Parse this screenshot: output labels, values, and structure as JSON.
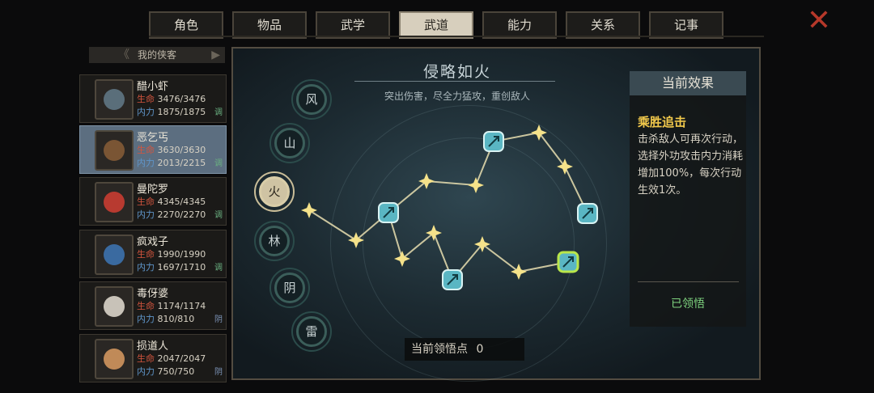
{
  "tabs": [
    {
      "label": "角色"
    },
    {
      "label": "物品"
    },
    {
      "label": "武学"
    },
    {
      "label": "武道",
      "active": true
    },
    {
      "label": "能力"
    },
    {
      "label": "关系"
    },
    {
      "label": "记事"
    }
  ],
  "close_icon": "close-x-icon",
  "hero_list": {
    "title": "我的侠客",
    "heroes": [
      {
        "name": "醋小虾",
        "hp_label": "生命",
        "hp": "3476/3476",
        "mp_label": "内力",
        "mp": "1875/1875",
        "tag": "调",
        "color": "#5a6e7a"
      },
      {
        "name": "恶乞丐",
        "hp_label": "生命",
        "hp": "3630/3630",
        "mp_label": "内力",
        "mp": "2013/2215",
        "tag": "调",
        "color": "#7a5534",
        "selected": true
      },
      {
        "name": "曼陀罗",
        "hp_label": "生命",
        "hp": "4345/4345",
        "mp_label": "内力",
        "mp": "2270/2270",
        "tag": "调",
        "color": "#b83a30"
      },
      {
        "name": "疯戏子",
        "hp_label": "生命",
        "hp": "1990/1990",
        "mp_label": "内力",
        "mp": "1697/1710",
        "tag": "调",
        "color": "#3a6aa0"
      },
      {
        "name": "毒伢婆",
        "hp_label": "生命",
        "hp": "1174/1174",
        "mp_label": "内力",
        "mp": "810/810",
        "tag": "阴",
        "color": "#c8c2b8"
      },
      {
        "name": "损道人",
        "hp_label": "生命",
        "hp": "2047/2047",
        "mp_label": "内力",
        "mp": "750/750",
        "tag": "阴",
        "color": "#c08a58"
      }
    ]
  },
  "path": {
    "title": "侵略如火",
    "subtitle": "突出伤害，尽全力猛攻，重创敌人"
  },
  "elements": [
    {
      "label": "风"
    },
    {
      "label": "山"
    },
    {
      "label": "火",
      "active": true
    },
    {
      "label": "林"
    },
    {
      "label": "阴"
    },
    {
      "label": "雷"
    }
  ],
  "effect": {
    "header": "当前效果",
    "name": "乘胜追击",
    "description": "击杀敌人可再次行动，选择外功攻击内力消耗增加100%，每次行动生效1次。",
    "status": "已领悟"
  },
  "points": {
    "label": "当前领悟点",
    "value": "0"
  },
  "colors": {
    "accent_gold": "#f2c94c",
    "active_green": "#7fd47f",
    "hp_red": "#d4553e",
    "mp_blue": "#5f95c9",
    "close_red": "#b6382a"
  }
}
